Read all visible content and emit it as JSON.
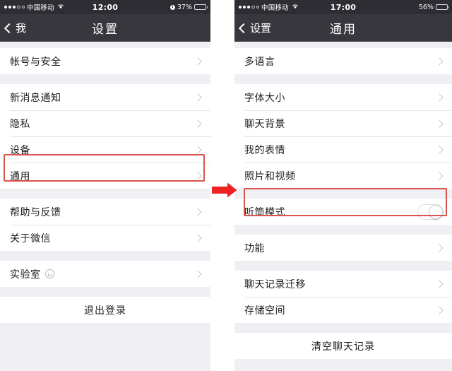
{
  "left_phone": {
    "status_bar": {
      "carrier": "中国移动",
      "time": "12:00",
      "battery_percent": "37%",
      "battery_level": 37,
      "signal_dots_filled": 3,
      "signal_dots_hollow": 2,
      "wifi_icon": "wifi-icon",
      "alarm_icon": "alarm-icon"
    },
    "nav": {
      "back_label": "我",
      "title": "设置",
      "back_icon": "chevron-left-icon"
    },
    "groups": [
      {
        "rows": [
          {
            "label": "帐号与安全",
            "accessory": "chevron"
          }
        ]
      },
      {
        "rows": [
          {
            "label": "新消息通知",
            "accessory": "chevron"
          },
          {
            "label": "隐私",
            "accessory": "chevron"
          },
          {
            "label": "设备",
            "accessory": "chevron"
          },
          {
            "label": "通用",
            "accessory": "chevron",
            "highlighted": true
          }
        ]
      },
      {
        "rows": [
          {
            "label": "帮助与反馈",
            "accessory": "chevron"
          },
          {
            "label": "关于微信",
            "accessory": "chevron"
          }
        ]
      },
      {
        "rows": [
          {
            "label": "实验室",
            "accessory": "chevron",
            "badge_icon": "lab-bulb-icon"
          }
        ]
      },
      {
        "rows": [
          {
            "label": "退出登录",
            "accessory": "none",
            "centered": true
          }
        ]
      }
    ]
  },
  "right_phone": {
    "status_bar": {
      "carrier": "中国移动",
      "time": "17:00",
      "battery_percent": "56%",
      "battery_level": 56,
      "signal_dots_filled": 3,
      "signal_dots_hollow": 2,
      "wifi_icon": "wifi-icon"
    },
    "nav": {
      "back_label": "设置",
      "title": "通用",
      "back_icon": "chevron-left-icon"
    },
    "groups": [
      {
        "rows": [
          {
            "label": "多语言",
            "accessory": "chevron"
          }
        ]
      },
      {
        "rows": [
          {
            "label": "字体大小",
            "accessory": "chevron"
          },
          {
            "label": "聊天背景",
            "accessory": "chevron"
          },
          {
            "label": "我的表情",
            "accessory": "chevron"
          },
          {
            "label": "照片和视频",
            "accessory": "chevron"
          }
        ]
      },
      {
        "rows": [
          {
            "label": "听筒模式",
            "accessory": "toggle",
            "toggle_on": false,
            "highlighted": true
          }
        ]
      },
      {
        "rows": [
          {
            "label": "功能",
            "accessory": "chevron"
          }
        ]
      },
      {
        "rows": [
          {
            "label": "聊天记录迁移",
            "accessory": "chevron"
          },
          {
            "label": "存储空间",
            "accessory": "chevron"
          }
        ]
      },
      {
        "rows": [
          {
            "label": "清空聊天记录",
            "accessory": "none",
            "centered": true
          }
        ]
      }
    ]
  },
  "annotations": {
    "arrow_icon": "red-right-arrow-icon",
    "highlight_color": "#d9534f",
    "highlight_general": "通用",
    "highlight_earpiece": "听筒模式"
  },
  "colors": {
    "status_bar_bg": "#2d2d33",
    "nav_bar_bg": "#37373d",
    "list_bg": "#efeff4",
    "row_bg": "#ffffff",
    "text": "#1c1c1e",
    "chevron": "#c5c5c9",
    "accent_red": "#d9534f"
  }
}
